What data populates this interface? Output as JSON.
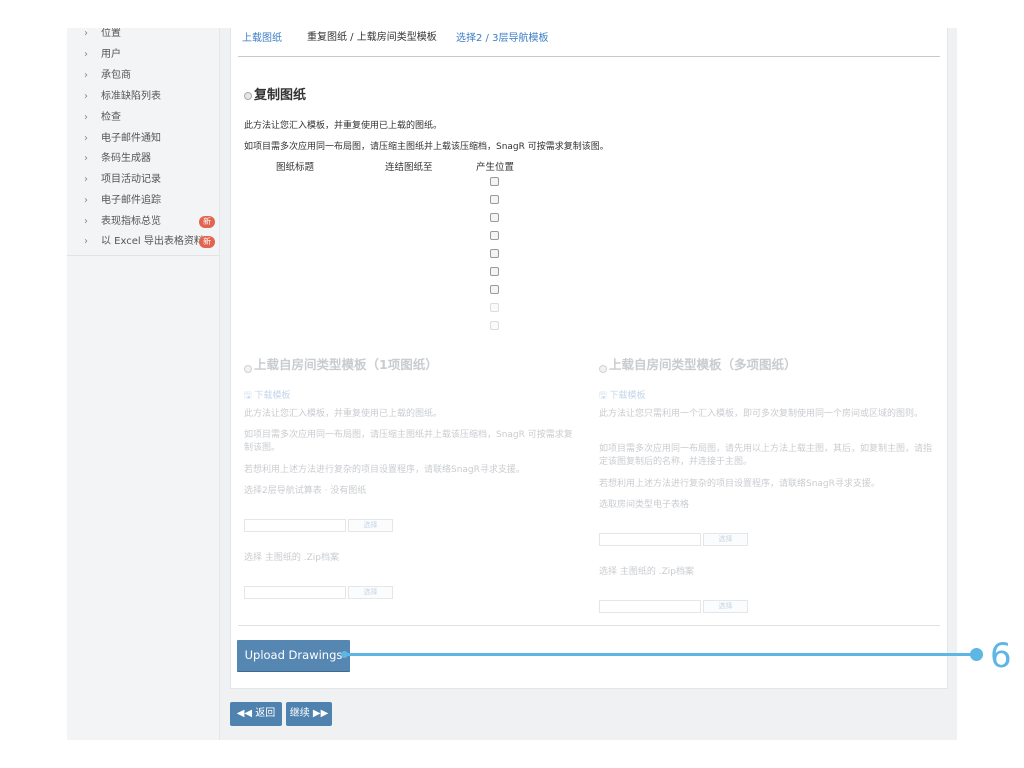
{
  "sidebar": {
    "items": [
      {
        "label": "位置",
        "badge": ""
      },
      {
        "label": "用户",
        "badge": ""
      },
      {
        "label": "承包商",
        "badge": ""
      },
      {
        "label": "标准缺陷列表",
        "badge": ""
      },
      {
        "label": "检查",
        "badge": ""
      },
      {
        "label": "电子邮件通知",
        "badge": ""
      },
      {
        "label": "条码生成器",
        "badge": ""
      },
      {
        "label": "项目活动记录",
        "badge": ""
      },
      {
        "label": "电子邮件追踪",
        "badge": ""
      },
      {
        "label": "表现指标总览",
        "badge": "新"
      },
      {
        "label": "以 Excel 导出表格资料",
        "badge": "新"
      }
    ],
    "chevron": "›"
  },
  "tabs": [
    {
      "label": "上载图纸"
    },
    {
      "label": "重复图纸 / 上载房间类型模板"
    },
    {
      "label": "选择2 / 3层导航模板"
    }
  ],
  "copy_section": {
    "title": "复制图纸",
    "desc1": "此方法让您汇入模板，并重复使用已上载的图纸。",
    "desc2": "如项目需多次应用同一布局图，请压缩主图纸并上载该压缩档，SnagR 可按需求复制该图。",
    "col_title": "图纸标题",
    "col_link": "连结图纸至",
    "col_position": "产生位置",
    "checkbox_count": 9
  },
  "single_section": {
    "title": "上载自房间类型模板（1项图纸）",
    "download": "下载模板",
    "desc1": "此方法让您汇入模板，并重复使用已上载的图纸。",
    "desc2": "如项目需多次应用同一布局图，请压缩主图纸并上载该压缩档，SnagR 可按需求复制该图。",
    "desc3": "若想利用上述方法进行复杂的项目设置程序，请联络SnagR寻求支援。",
    "label_excel": "选择2层导航试算表 · 没有图纸",
    "choose": "选择",
    "label_zip": "选择 主图纸的 .Zip档案",
    "choose2": "选择"
  },
  "multi_section": {
    "title": "上载自房间类型模板（多项图纸）",
    "download": "下载模板",
    "desc1": "此方法让您只需利用一个汇入模板，即可多次复制使用同一个房间或区域的图则。",
    "desc2": "如项目需多次应用同一布局图，请先用以上方法上载主图，其后，如复制主图，请指定该图复制后的名称，并连接于主图。",
    "desc3": "若想利用上述方法进行复杂的项目设置程序，请联络SnagR寻求支援。",
    "label_excel": "选取房间类型电子表格",
    "choose": "选择",
    "label_zip": "选择 主图纸的 .Zip档案",
    "choose2": "选择"
  },
  "upload_button": "Upload Drawings",
  "back_button": "◀◀ 返回",
  "next_button": "继续 ▶▶",
  "callout_number": "6",
  "colors": {
    "accent": "#5687b2",
    "callout": "#5db6e3",
    "badge": "#e2644f"
  }
}
